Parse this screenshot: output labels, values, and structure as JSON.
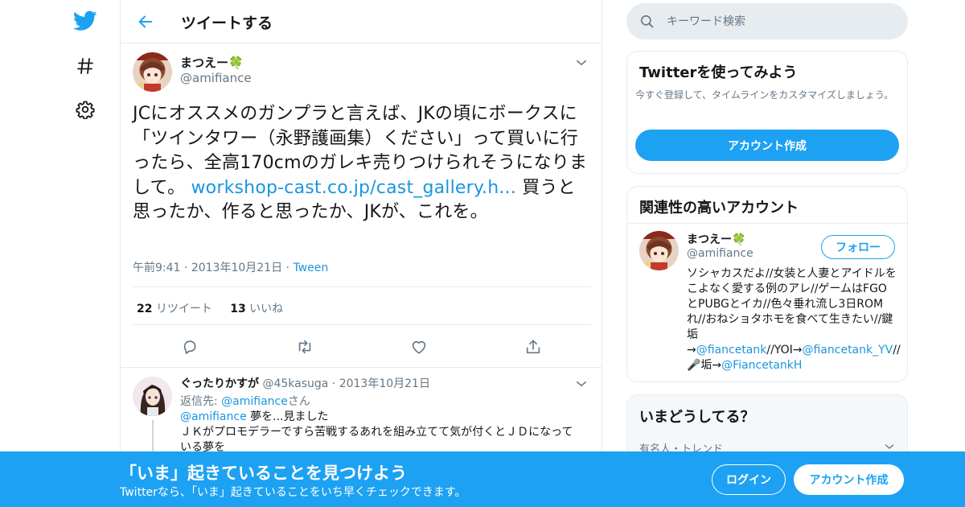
{
  "header": {
    "title": "ツイートする"
  },
  "tweet": {
    "author_name": "まつえー🍀",
    "author_handle": "@amifiance",
    "text_part1": "JCにオススメのガンプラと言えば、JKの頃にボークスに「ツインタワー（永野護画集）ください」って買いに行ったら、全高170cmのガレキ売りつけられそうになりまして。",
    "link_text": "workshop-cast.co.jp/cast_gallery.h...",
    "text_part2": "買うと思ったか、作ると思ったか、JKが、これを。",
    "time": "午前9:41",
    "date": "2013年10月21日",
    "source": "Tween",
    "retweet_count": "22",
    "retweet_label": "リツイート",
    "like_count": "13",
    "like_label": "いいね"
  },
  "reply": {
    "author_name": "ぐったりかすが",
    "author_handle": "@45kasuga",
    "date": "2013年10月21日",
    "reply_to_label": "返信先:",
    "reply_to_handle": "@amifiance",
    "reply_to_suffix": "さん",
    "mention": "@amifiance",
    "line1": "夢を...見ました",
    "line2": "ＪＫがプロモデラーですら苦戦するあれを組み立てて気が付くとＪＤになっている夢を"
  },
  "search": {
    "placeholder": "キーワード検索"
  },
  "try_card": {
    "title": "Twitterを使ってみよう",
    "description": "今すぐ登録して、タイムラインをカスタマイズしましょう。",
    "button": "アカウント作成"
  },
  "related_card": {
    "title": "関連性の高いアカウント",
    "name": "まつえー🍀",
    "handle": "@amifiance",
    "follow": "フォロー",
    "bio_1": "ソシャカスだよ//女装と人妻とアイドルをこよなく愛する例のアレ//ゲームはFGOとPUBGとイカ//色々垂れ流し3日ROMれ//おねショタホモを食べて生きたい//鍵垢→",
    "bio_link1": "@fiancetank",
    "bio_2": "//YOI→",
    "bio_link2": "@fiancetank_YV",
    "bio_3": "//🎤垢→",
    "bio_link3": "@FiancetankH"
  },
  "now_card": {
    "title": "いまどうしてる？",
    "subtitle": "有名人・トレンド"
  },
  "banner": {
    "title": "「いま」起きていることを見つけよう",
    "subtitle": "Twitterなら、「いま」起きていることをいち早くチェックできます。",
    "login": "ログイン",
    "signup": "アカウント作成"
  },
  "colors": {
    "brand": "#1da1f2",
    "link": "#1b95e0",
    "muted": "#657786"
  }
}
